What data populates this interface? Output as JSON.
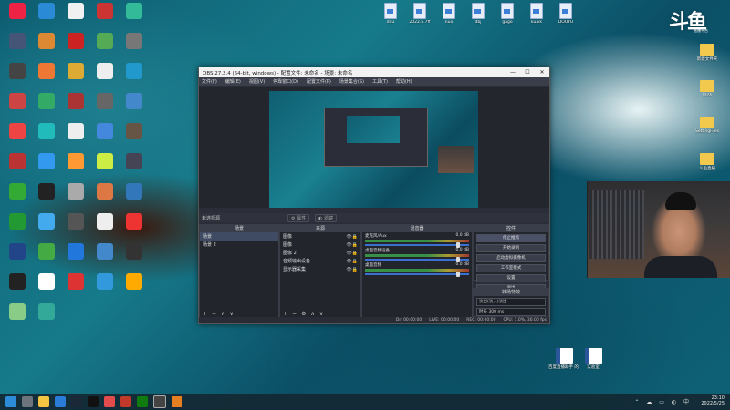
{
  "desktop": {
    "top_files": [
      {
        "label": "dau"
      },
      {
        "label": "2022.5.7ff"
      },
      {
        "label": "nuo"
      },
      {
        "label": "dbj"
      },
      {
        "label": "gago"
      },
      {
        "label": "kuaik"
      },
      {
        "label": "DOUYU"
      }
    ],
    "right_folders": [
      {
        "label": "新建文件夹"
      },
      {
        "label": "WPX"
      },
      {
        "label": "SettingFiles"
      },
      {
        "label": "斗鱼直播"
      }
    ],
    "bottom_docs": [
      {
        "label": "百度直播助手 的介绍"
      },
      {
        "label": "实验室"
      }
    ]
  },
  "logo": {
    "text": "斗鱼",
    "sub": "直播平台"
  },
  "obs": {
    "title": "OBS 27.2.4 (64-bit, windows) - 配置文件: 未命名 - 场景: 未命名",
    "window_controls": [
      "—",
      "☐",
      "✕"
    ],
    "menu": [
      "文件(F)",
      "编辑(E)",
      "视图(V)",
      "停靠窗口(D)",
      "配置文件(P)",
      "场景集合(S)",
      "工具(T)",
      "帮助(H)"
    ],
    "toolbar": {
      "no_source": "未选择源",
      "props": "⚙ 属性",
      "filters": "◐ 滤镜"
    },
    "scenes": {
      "title": "场景",
      "items": [
        "场景",
        "场景 2"
      ],
      "selected": 0
    },
    "sources": {
      "title": "来源",
      "items": [
        "图像",
        "图像",
        "图像 2",
        "音频输出设备",
        "显示器采集"
      ]
    },
    "mixer": {
      "title": "混音器",
      "channels": [
        {
          "name": "麦克风/Aux",
          "db": "0.0 dB"
        },
        {
          "name": "桌面音频设备",
          "db": "0.0 dB"
        },
        {
          "name": "桌面音频",
          "db": "0.0 dB"
        }
      ]
    },
    "transitions": {
      "title": "转场特效",
      "type": "淡出(淡入)淡出",
      "duration_label": "时长",
      "duration": "300 ms"
    },
    "controls": {
      "title": "控件",
      "buttons": [
        "停止推流",
        "开始录制",
        "启动虚拟摄像机",
        "工作室模式",
        "设置",
        "退出"
      ],
      "active": 0
    },
    "status": {
      "drop": "Dr: 00:00:00",
      "live": "LIVE: 00:00:00",
      "rec": "REC: 00:00:00",
      "cpu": "CPU: 1.0%, 30.00 fps"
    },
    "dock_foot": [
      "+",
      "−",
      "∧",
      "∨"
    ]
  },
  "taskbar": {
    "time": "23:10",
    "date": "2022/5/25"
  }
}
